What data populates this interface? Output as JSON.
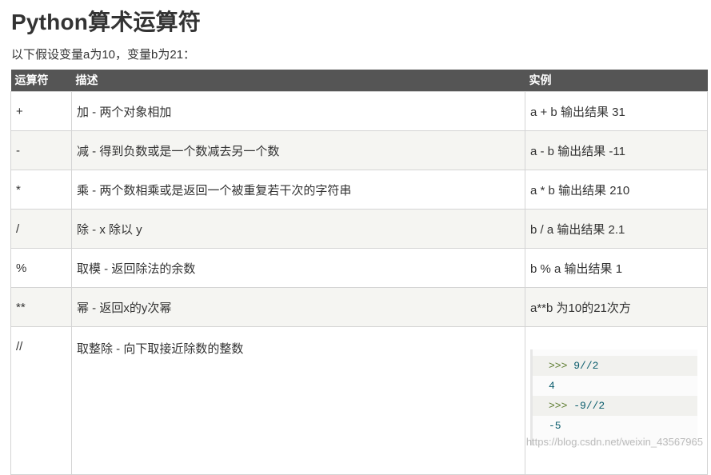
{
  "title": "Python算术运算符",
  "intro": "以下假设变量a为10，变量b为21：",
  "table": {
    "headers": [
      "运算符",
      "描述",
      "实例"
    ],
    "rows": [
      {
        "op": "+",
        "desc": "加 - 两个对象相加",
        "example": "a + b 输出结果 31"
      },
      {
        "op": "-",
        "desc": "减 - 得到负数或是一个数减去另一个数",
        "example": "a - b 输出结果 -11"
      },
      {
        "op": "*",
        "desc": "乘 - 两个数相乘或是返回一个被重复若干次的字符串",
        "example": "a * b 输出结果 210"
      },
      {
        "op": "/",
        "desc": "除 - x 除以 y",
        "example": "b / a 输出结果 2.1"
      },
      {
        "op": "%",
        "desc": "取模 - 返回除法的余数",
        "example": "b % a 输出结果 1"
      },
      {
        "op": "**",
        "desc": "幂 - 返回x的y次幂",
        "example": "a**b 为10的21次方"
      },
      {
        "op": "//",
        "desc": "取整除 - 向下取接近除数的整数",
        "example": ""
      }
    ]
  },
  "code": {
    "lines": [
      {
        "prompt": ">>> ",
        "text": "9//2"
      },
      {
        "prompt": "",
        "text": "4"
      },
      {
        "prompt": ">>> ",
        "text": "-9//2"
      },
      {
        "prompt": "",
        "text": "-5"
      }
    ]
  },
  "watermark": "https://blog.csdn.net/weixin_43567965"
}
